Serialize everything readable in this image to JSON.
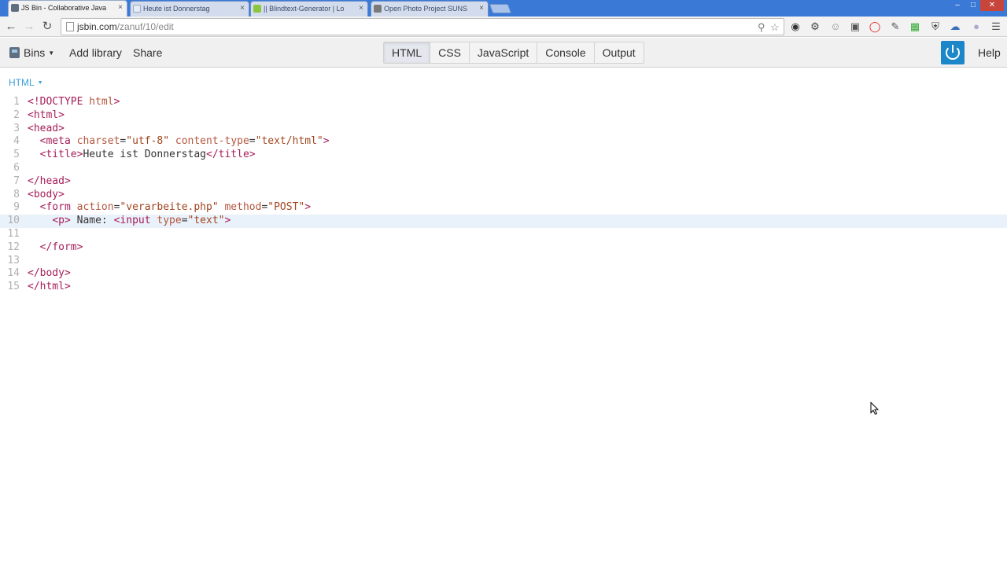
{
  "browser": {
    "tabs": [
      {
        "title": "JS Bin - Collaborative Java",
        "close": "×",
        "favicon_color": "#5f6f80"
      },
      {
        "title": "Heute ist Donnerstag",
        "close": "×",
        "favicon_color": "#e6ecf5"
      },
      {
        "title": "|| Blindtext-Generator | Lo",
        "close": "×",
        "favicon_color": "#8cc63f"
      },
      {
        "title": "Open Photo Project SUNS",
        "close": "×",
        "favicon_color": "#7a7a7a"
      }
    ],
    "window_controls": {
      "minimize": "–",
      "maximize": "□",
      "close": "✕"
    },
    "address": {
      "domain": "jsbin.com",
      "path": "/zanuf/10/edit"
    }
  },
  "jsbin": {
    "bins_label": "Bins",
    "add_library_label": "Add library",
    "share_label": "Share",
    "panels": [
      "HTML",
      "CSS",
      "JavaScript",
      "Console",
      "Output"
    ],
    "active_panel": "HTML",
    "help_label": "Help",
    "accent_color": "#1b87c9"
  },
  "editor": {
    "panel_label": "HTML",
    "current_line": 10,
    "lines": [
      {
        "num": "1",
        "code": "<!DOCTYPE html>"
      },
      {
        "num": "2",
        "code": "<html>"
      },
      {
        "num": "3",
        "code": "<head>"
      },
      {
        "num": "4",
        "code": "  <meta charset=\"utf-8\" content-type=\"text/html\">"
      },
      {
        "num": "5",
        "code": "  <title>Heute ist Donnerstag</title>"
      },
      {
        "num": "6",
        "code": ""
      },
      {
        "num": "7",
        "code": "</head>"
      },
      {
        "num": "8",
        "code": "<body>"
      },
      {
        "num": "9",
        "code": "  <form action=\"verarbeite.php\" method=\"POST\">"
      },
      {
        "num": "10",
        "code": "    <p> Name: <input type=\"text\">"
      },
      {
        "num": "11",
        "code": ""
      },
      {
        "num": "12",
        "code": "  </form>"
      },
      {
        "num": "13",
        "code": ""
      },
      {
        "num": "14",
        "code": "</body>"
      },
      {
        "num": "15",
        "code": "</html>"
      }
    ]
  }
}
